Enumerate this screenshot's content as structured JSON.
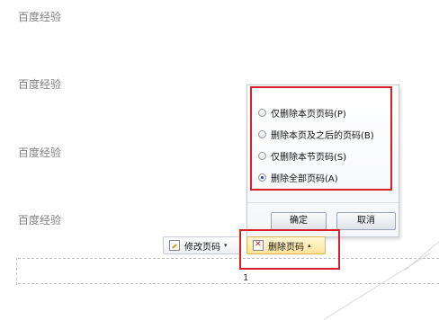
{
  "document": {
    "watermark_lines": [
      "百度经验",
      "百度经验",
      "百度经验",
      "百度经验"
    ],
    "page_number": "1"
  },
  "dialog": {
    "options": [
      {
        "label": "仅删除本页页码(P)",
        "checked": false
      },
      {
        "label": "删除本页及之后的页码(B)",
        "checked": false
      },
      {
        "label": "仅删除本节页码(S)",
        "checked": false
      },
      {
        "label": "删除全部页码(A)",
        "checked": true
      }
    ],
    "ok_label": "确定",
    "cancel_label": "取消"
  },
  "toolbar": {
    "edit_label": "修改页码",
    "edit_caret": "▾",
    "delete_label": "删除页码",
    "delete_caret": "▴"
  },
  "colors": {
    "highlight_border": "#d7202a",
    "watermark_text": "#808080"
  }
}
